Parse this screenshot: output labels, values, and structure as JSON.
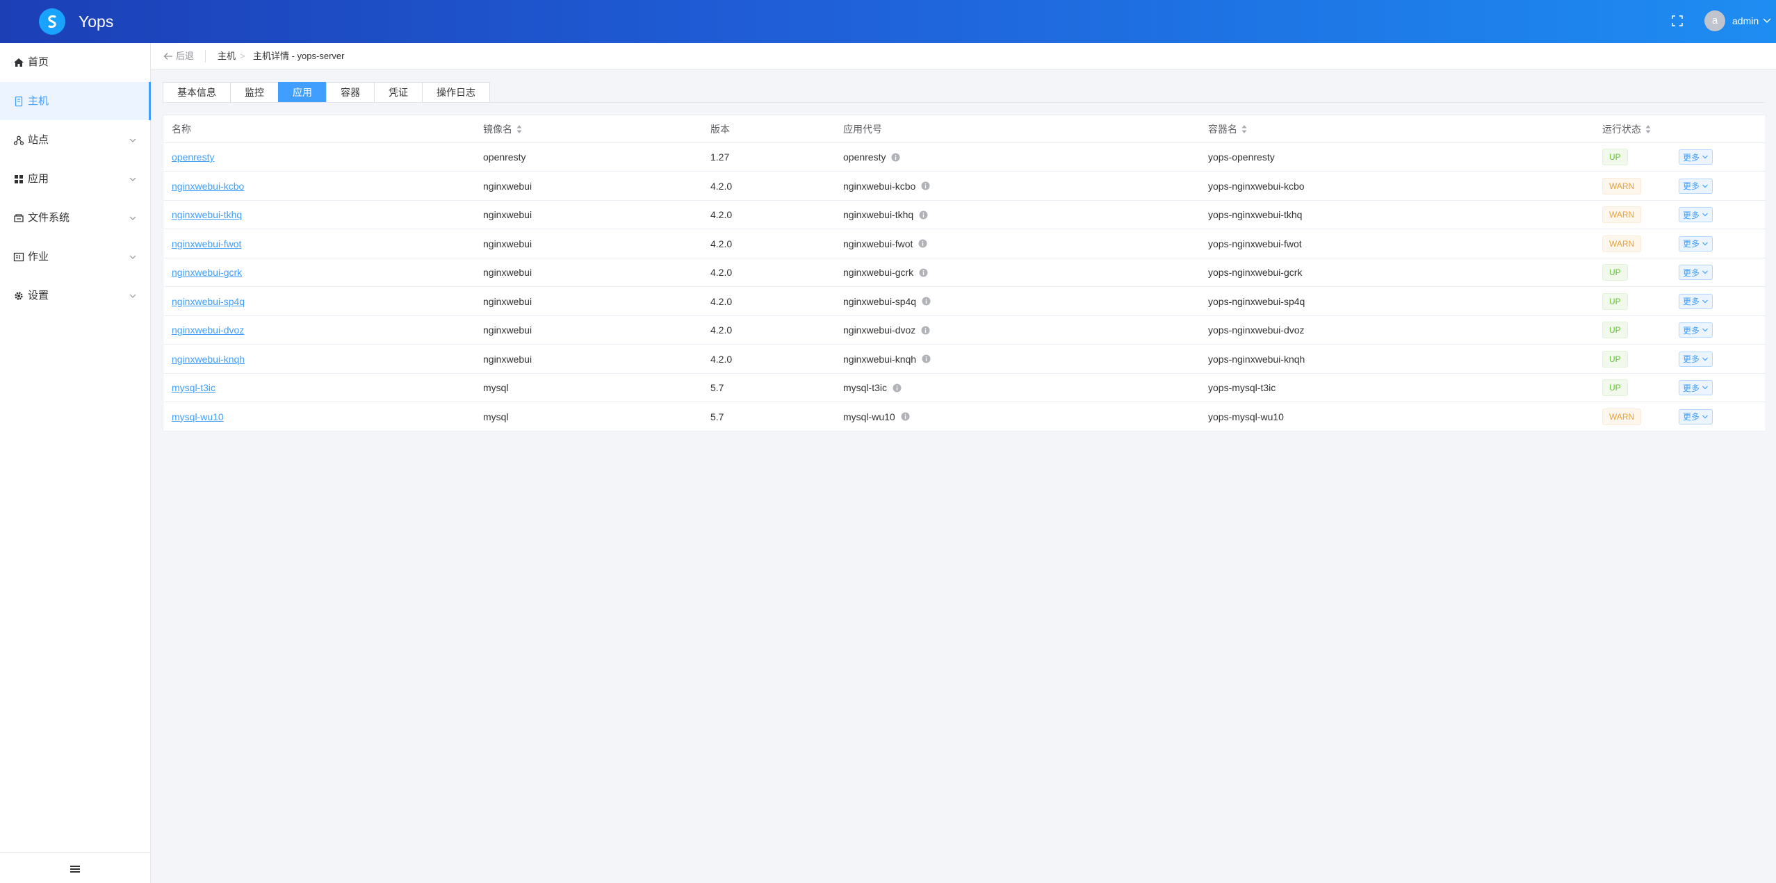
{
  "header": {
    "app_name": "Yops",
    "user_initial": "a",
    "username": "admin"
  },
  "sidebar": {
    "items": [
      {
        "label": "首页",
        "icon": "home-icon",
        "active": false,
        "has_children": false
      },
      {
        "label": "主机",
        "icon": "server-icon",
        "active": true,
        "has_children": false
      },
      {
        "label": "站点",
        "icon": "site-icon",
        "active": false,
        "has_children": true
      },
      {
        "label": "应用",
        "icon": "apps-icon",
        "active": false,
        "has_children": true
      },
      {
        "label": "文件系统",
        "icon": "filesystem-icon",
        "active": false,
        "has_children": true
      },
      {
        "label": "作业",
        "icon": "job-icon",
        "active": false,
        "has_children": true
      },
      {
        "label": "设置",
        "icon": "gear-icon",
        "active": false,
        "has_children": true
      }
    ]
  },
  "breadcrumb": {
    "back_label": "后退",
    "level1": "主机",
    "separator": ">",
    "level2": "主机详情 - yops-server"
  },
  "tabs": [
    {
      "label": "基本信息",
      "active": false
    },
    {
      "label": "监控",
      "active": false
    },
    {
      "label": "应用",
      "active": true
    },
    {
      "label": "容器",
      "active": false
    },
    {
      "label": "凭证",
      "active": false
    },
    {
      "label": "操作日志",
      "active": false
    }
  ],
  "table": {
    "columns": [
      "名称",
      "镜像名",
      "版本",
      "应用代号",
      "容器名",
      "运行状态"
    ],
    "sortable": [
      false,
      true,
      false,
      false,
      true,
      true
    ],
    "more_label": "更多",
    "rows": [
      {
        "name": "openresty",
        "image": "openresty",
        "version": "1.27",
        "code": "openresty",
        "container": "yops-openresty",
        "status": "UP"
      },
      {
        "name": "nginxwebui-kcbo",
        "image": "nginxwebui",
        "version": "4.2.0",
        "code": "nginxwebui-kcbo",
        "container": "yops-nginxwebui-kcbo",
        "status": "WARN"
      },
      {
        "name": "nginxwebui-tkhq",
        "image": "nginxwebui",
        "version": "4.2.0",
        "code": "nginxwebui-tkhq",
        "container": "yops-nginxwebui-tkhq",
        "status": "WARN"
      },
      {
        "name": "nginxwebui-fwot",
        "image": "nginxwebui",
        "version": "4.2.0",
        "code": "nginxwebui-fwot",
        "container": "yops-nginxwebui-fwot",
        "status": "WARN"
      },
      {
        "name": "nginxwebui-gcrk",
        "image": "nginxwebui",
        "version": "4.2.0",
        "code": "nginxwebui-gcrk",
        "container": "yops-nginxwebui-gcrk",
        "status": "UP"
      },
      {
        "name": "nginxwebui-sp4q",
        "image": "nginxwebui",
        "version": "4.2.0",
        "code": "nginxwebui-sp4q",
        "container": "yops-nginxwebui-sp4q",
        "status": "UP"
      },
      {
        "name": "nginxwebui-dvoz",
        "image": "nginxwebui",
        "version": "4.2.0",
        "code": "nginxwebui-dvoz",
        "container": "yops-nginxwebui-dvoz",
        "status": "UP"
      },
      {
        "name": "nginxwebui-knqh",
        "image": "nginxwebui",
        "version": "4.2.0",
        "code": "nginxwebui-knqh",
        "container": "yops-nginxwebui-knqh",
        "status": "UP"
      },
      {
        "name": "mysql-t3ic",
        "image": "mysql",
        "version": "5.7",
        "code": "mysql-t3ic",
        "container": "yops-mysql-t3ic",
        "status": "UP"
      },
      {
        "name": "mysql-wu10",
        "image": "mysql",
        "version": "5.7",
        "code": "mysql-wu10",
        "container": "yops-mysql-wu10",
        "status": "WARN"
      }
    ]
  },
  "colors": {
    "accent": "#409eff",
    "up": "#67c23a",
    "warn": "#e6a23c"
  }
}
